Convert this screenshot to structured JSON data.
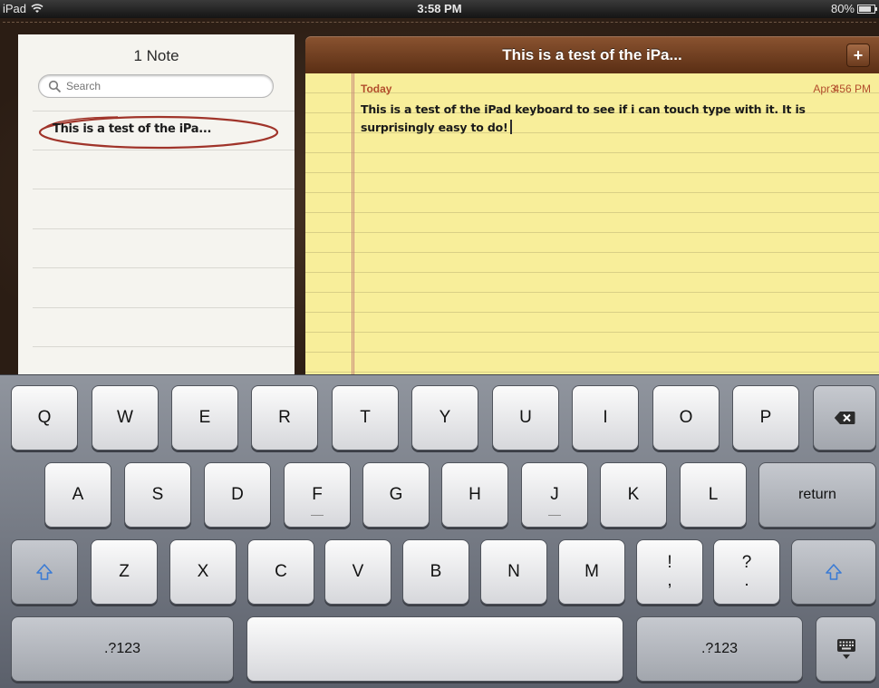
{
  "status_bar": {
    "device": "iPad",
    "time": "3:58 PM",
    "battery_percent": "80%",
    "battery_level": 0.8
  },
  "list": {
    "title": "1 Note",
    "search_placeholder": "Search",
    "notes": [
      "This is a test of the iPa..."
    ]
  },
  "note": {
    "title": "This is a test of the iPa...",
    "add_label": "+",
    "day": "Today",
    "date": "Apr 4",
    "time": "3:56 PM",
    "body": "This is a test of the iPad keyboard to see if i can touch type with it. It is surprisingly easy to do!"
  },
  "keyboard": {
    "row1": [
      "Q",
      "W",
      "E",
      "R",
      "T",
      "Y",
      "U",
      "I",
      "O",
      "P"
    ],
    "row2": [
      "A",
      "S",
      "D",
      "F",
      "G",
      "H",
      "J",
      "K",
      "L"
    ],
    "row3": [
      "Z",
      "X",
      "C",
      "V",
      "B",
      "N",
      "M"
    ],
    "return_label": "return",
    "punct1_top": "!",
    "punct1_bottom": ",",
    "punct2_top": "?",
    "punct2_bottom": ".",
    "numbers_label": ".?123",
    "icons": {
      "delete": "backspace-icon",
      "shift": "shift-icon",
      "hide": "hide-keyboard-icon",
      "search": "search-icon",
      "wifi": "wifi-icon"
    }
  },
  "colors": {
    "accent_red": "#b24d2c",
    "paper": "#f8ee9a",
    "header": "#6b3a1c",
    "shift_blue": "#3a7bd5"
  }
}
